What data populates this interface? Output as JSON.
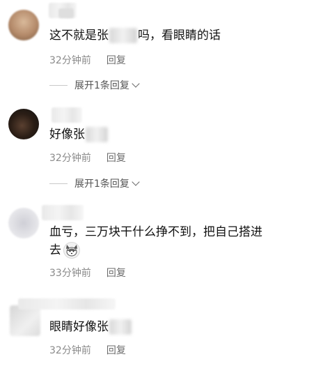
{
  "comments": [
    {
      "text_before": "这不就是张",
      "text_after": "吗，看眼睛的话",
      "time": "32分钟前",
      "reply_label": "回复",
      "expand_label": "展开1条回复"
    },
    {
      "text_before": "好像张",
      "text_after": "",
      "time": "32分钟前",
      "reply_label": "回复",
      "expand_label": "展开1条回复"
    },
    {
      "text_line1": "血亏，三万块干什么挣不到，把自己搭进",
      "text_line2": "去",
      "emoji": "husky-emoji-icon",
      "time": "33分钟前",
      "reply_label": "回复"
    },
    {
      "text_before": "眼睛好像张",
      "text_after": "",
      "time": "32分钟前",
      "reply_label": "回复"
    }
  ],
  "colors": {
    "text": "#111111",
    "meta": "#8a8a8a",
    "divider": "#c9c9c9"
  }
}
